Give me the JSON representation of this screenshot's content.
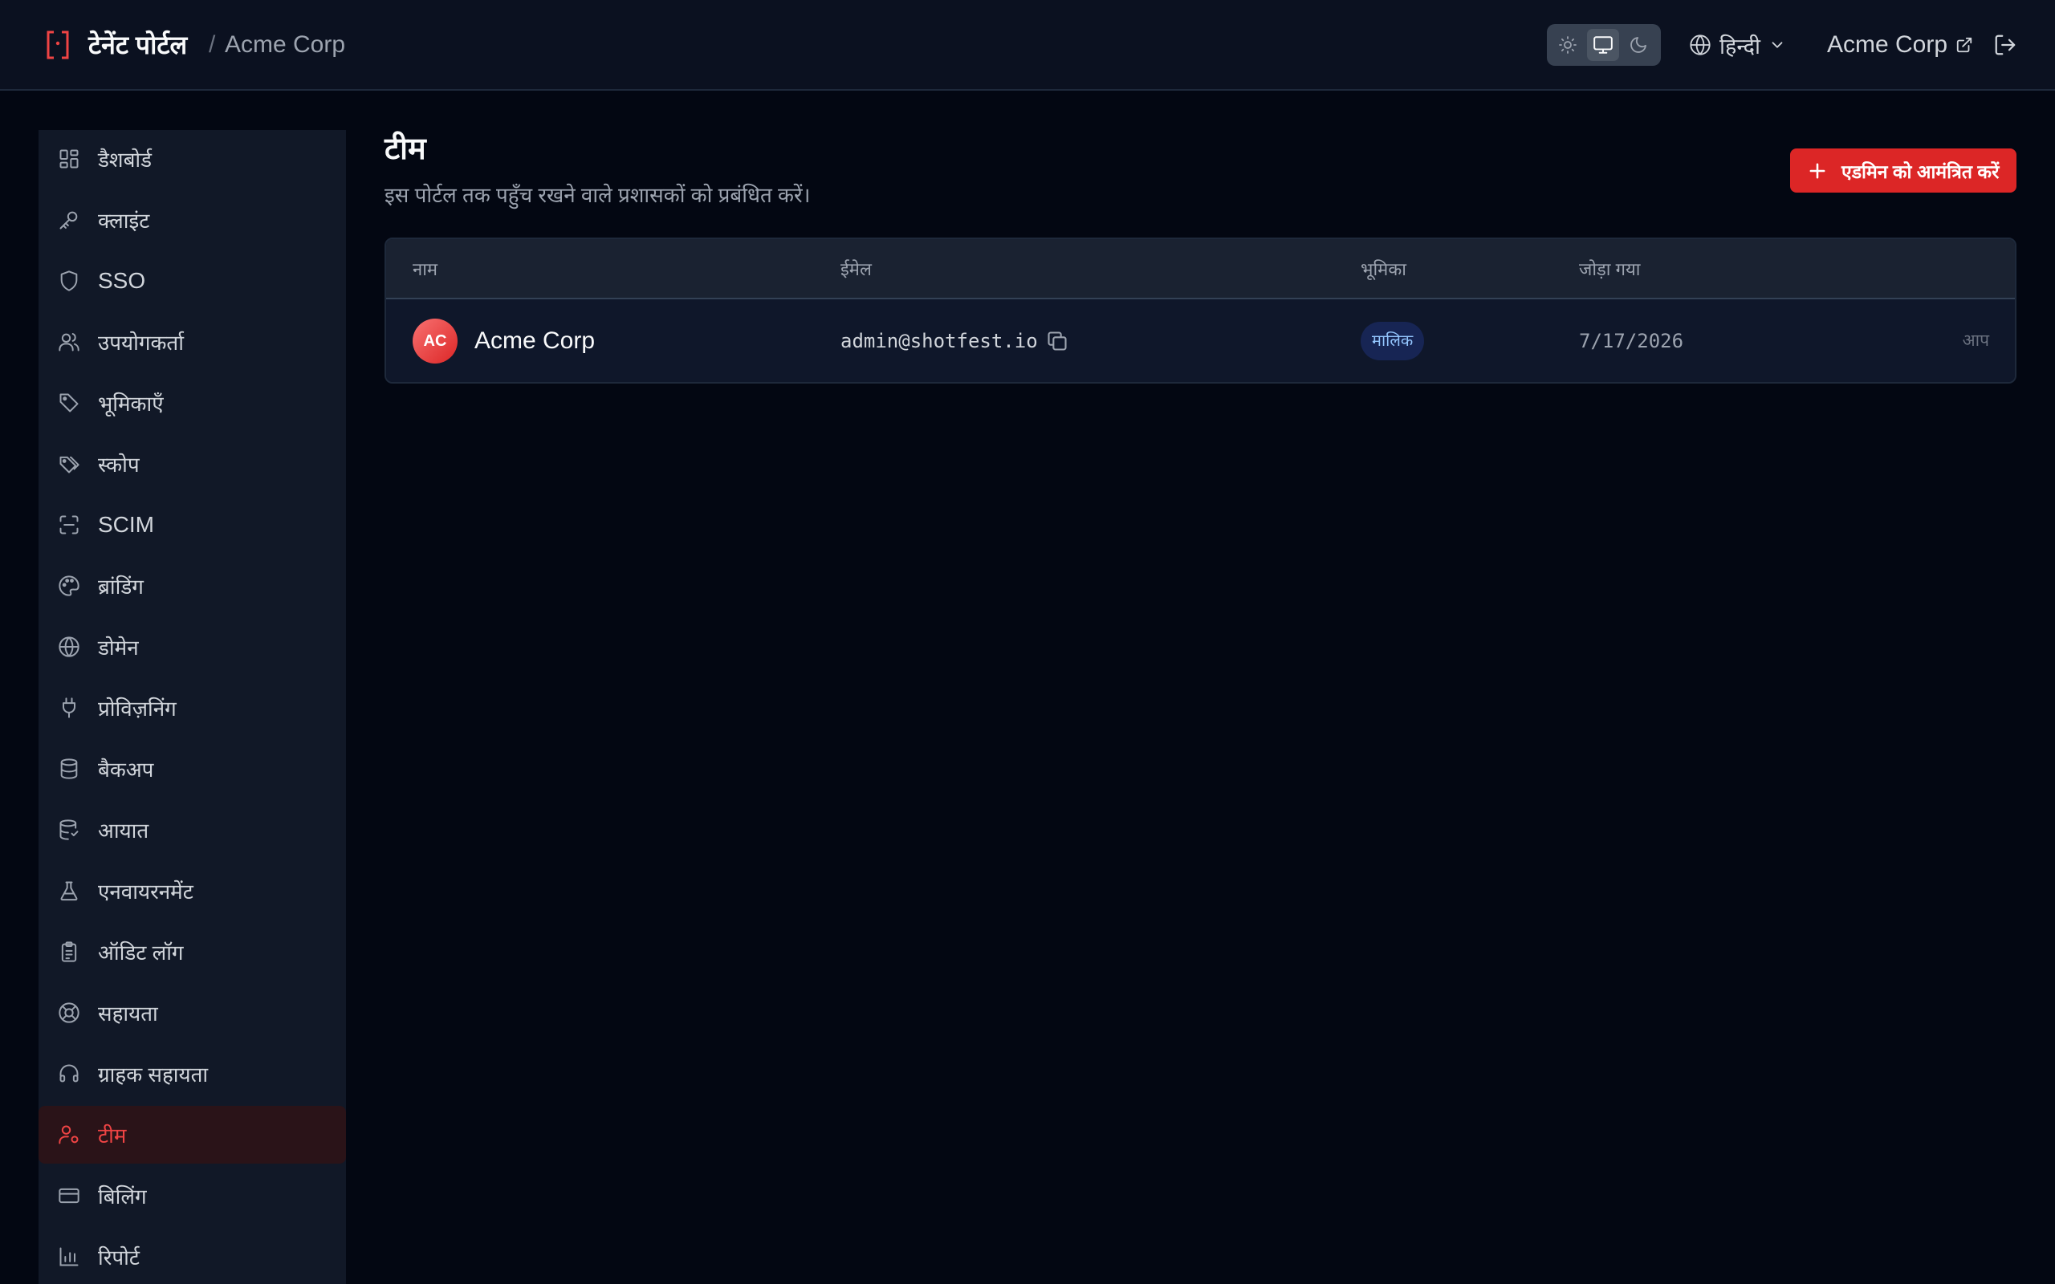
{
  "header": {
    "app_title": "टेनेंट पोर्टल",
    "breadcrumb_separator": "/",
    "tenant_name": "Acme Corp",
    "theme": {
      "active": "system"
    },
    "language_label": "हिन्दी",
    "tenant_link_label": "Acme Corp"
  },
  "sidebar": {
    "items": [
      {
        "label": "डैशबोर्ड",
        "icon": "dashboard-icon"
      },
      {
        "label": "क्लाइंट",
        "icon": "key-icon"
      },
      {
        "label": "SSO",
        "icon": "shield-icon"
      },
      {
        "label": "उपयोगकर्ता",
        "icon": "users-icon"
      },
      {
        "label": "भूमिकाएँ",
        "icon": "tag-icon"
      },
      {
        "label": "स्कोप",
        "icon": "tags-icon"
      },
      {
        "label": "SCIM",
        "icon": "scan-icon"
      },
      {
        "label": "ब्रांडिंग",
        "icon": "palette-icon"
      },
      {
        "label": "डोमेन",
        "icon": "globe-icon"
      },
      {
        "label": "प्रोविज़निंग",
        "icon": "plug-icon"
      },
      {
        "label": "बैकअप",
        "icon": "database-icon"
      },
      {
        "label": "आयात",
        "icon": "database-import-icon"
      },
      {
        "label": "एनवायरनमेंट",
        "icon": "flask-icon"
      },
      {
        "label": "ऑडिट लॉग",
        "icon": "clipboard-icon"
      },
      {
        "label": "सहायता",
        "icon": "lifebuoy-icon"
      },
      {
        "label": "ग्राहक सहायता",
        "icon": "headset-icon"
      },
      {
        "label": "टीम",
        "icon": "user-cog-icon",
        "active": true
      },
      {
        "label": "बिलिंग",
        "icon": "credit-card-icon"
      },
      {
        "label": "रिपोर्ट",
        "icon": "bar-chart-icon"
      }
    ]
  },
  "main": {
    "title": "टीम",
    "subtitle": "इस पोर्टल तक पहुँच रखने वाले प्रशासकों को प्रबंधित करें।",
    "invite_button_label": "एडमिन को आमंत्रित करें",
    "table": {
      "columns": [
        "नाम",
        "ईमेल",
        "भूमिका",
        "जोड़ा गया"
      ],
      "rows": [
        {
          "initials": "AC",
          "name": "Acme Corp",
          "email": "admin@shotfest.io",
          "role": "मालिक",
          "joined": "7/17/2026",
          "note": "आप"
        }
      ]
    }
  },
  "colors": {
    "accent": "#dc2626",
    "background": "#030712",
    "sidebar": "#111827",
    "active_item_bg": "#2a1318",
    "badge_bg": "#172554",
    "badge_text": "#93c5fd"
  }
}
